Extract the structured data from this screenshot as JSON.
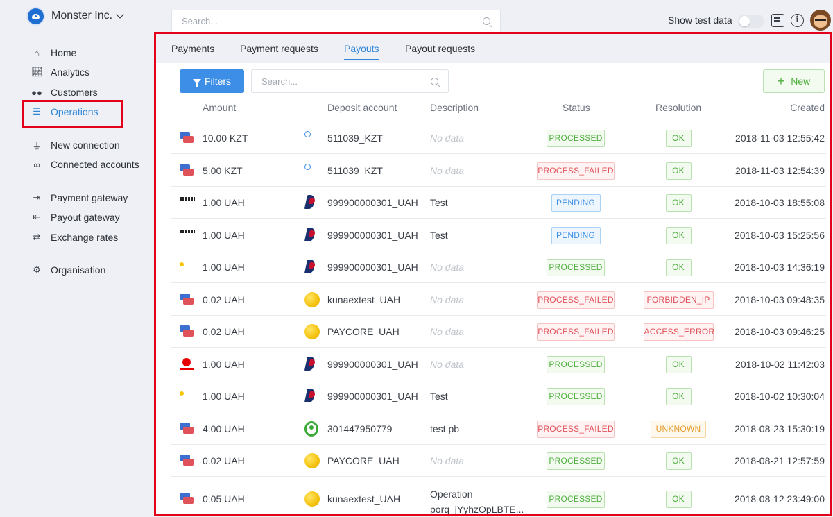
{
  "org": {
    "name": "Monster Inc."
  },
  "nav": {
    "home": "Home",
    "analytics": "Analytics",
    "customers": "Customers",
    "operations": "Operations",
    "new_connection": "New connection",
    "connected_accounts": "Connected accounts",
    "payment_gateway": "Payment gateway",
    "payout_gateway": "Payout gateway",
    "exchange_rates": "Exchange rates",
    "organisation": "Organisation"
  },
  "topbar": {
    "search_placeholder": "Search...",
    "show_test_label": "Show test data",
    "show_test_enabled": false
  },
  "tabs": {
    "payments": "Payments",
    "payment_requests": "Payment requests",
    "payouts": "Payouts",
    "payout_requests": "Payout requests",
    "active": "Payouts"
  },
  "toolbar": {
    "filters_label": "Filters",
    "search_placeholder": "Search...",
    "new_label": "New"
  },
  "table": {
    "columns": {
      "amount": "Amount",
      "deposit_account": "Deposit account",
      "description": "Description",
      "status": "Status",
      "resolution": "Resolution",
      "created": "Created"
    },
    "rows": [
      {
        "method_icon": "card-icon",
        "amount": "10.00 KZT",
        "account_icon": "paybox-icon",
        "account": "511039_KZT",
        "description": "No data",
        "status": "PROCESSED",
        "resolution": "OK",
        "created": "2018-11-03 12:55:42"
      },
      {
        "method_icon": "card-icon",
        "amount": "5.00 KZT",
        "account_icon": "paybox-icon",
        "account": "511039_KZT",
        "description": "No data",
        "status": "PROCESS_FAILED",
        "resolution": "OK",
        "created": "2018-11-03 12:54:39"
      },
      {
        "method_icon": "wallet-icon",
        "amount": "1.00 UAH",
        "account_icon": "paypal-icon",
        "account": "999900000301_UAH",
        "description": "Test",
        "status": "PENDING",
        "resolution": "OK",
        "created": "2018-10-03 18:55:08"
      },
      {
        "method_icon": "wallet-icon",
        "amount": "1.00 UAH",
        "account_icon": "paypal-icon",
        "account": "999900000301_UAH",
        "description": "Test",
        "status": "PENDING",
        "resolution": "OK",
        "created": "2018-10-03 15:25:56"
      },
      {
        "method_icon": "lifecell-icon",
        "amount": "1.00 UAH",
        "account_icon": "paypal-icon",
        "account": "999900000301_UAH",
        "description": "No data",
        "status": "PROCESSED",
        "resolution": "OK",
        "created": "2018-10-03 14:36:19"
      },
      {
        "method_icon": "card-icon",
        "amount": "0.02 UAH",
        "account_icon": "coin-icon",
        "account": "kunaextest_UAH",
        "description": "No data",
        "status": "PROCESS_FAILED",
        "resolution": "FORBIDDEN_IP",
        "created": "2018-10-03 09:48:35"
      },
      {
        "method_icon": "card-icon",
        "amount": "0.02 UAH",
        "account_icon": "coin-icon",
        "account": "PAYCORE_UAH",
        "description": "No data",
        "status": "PROCESS_FAILED",
        "resolution": "ACCESS_ERROR",
        "created": "2018-10-03 09:46:25"
      },
      {
        "method_icon": "vodafone-icon",
        "amount": "1.00 UAH",
        "account_icon": "paypal-icon",
        "account": "999900000301_UAH",
        "description": "No data",
        "status": "PROCESSED",
        "resolution": "OK",
        "created": "2018-10-02 11:42:03"
      },
      {
        "method_icon": "lifecell-icon",
        "amount": "1.00 UAH",
        "account_icon": "paypal-icon",
        "account": "999900000301_UAH",
        "description": "Test",
        "status": "PROCESSED",
        "resolution": "OK",
        "created": "2018-10-02 10:30:04"
      },
      {
        "method_icon": "card-icon",
        "amount": "4.00 UAH",
        "account_icon": "privat-icon",
        "account": "301447950779",
        "description": "test pb",
        "status": "PROCESS_FAILED",
        "resolution": "UNKNOWN",
        "created": "2018-08-23 15:30:19"
      },
      {
        "method_icon": "card-icon",
        "amount": "0.02 UAH",
        "account_icon": "coin-icon",
        "account": "PAYCORE_UAH",
        "description": "No data",
        "status": "PROCESSED",
        "resolution": "OK",
        "created": "2018-08-21 12:57:59"
      },
      {
        "method_icon": "card-icon",
        "amount": "0.05 UAH",
        "account_icon": "coin-icon",
        "account": "kunaextest_UAH",
        "description": "Operation porq_jYyhzOpLBTE...",
        "status": "PROCESSED",
        "resolution": "OK",
        "created": "2018-08-12 23:49:00"
      }
    ]
  }
}
